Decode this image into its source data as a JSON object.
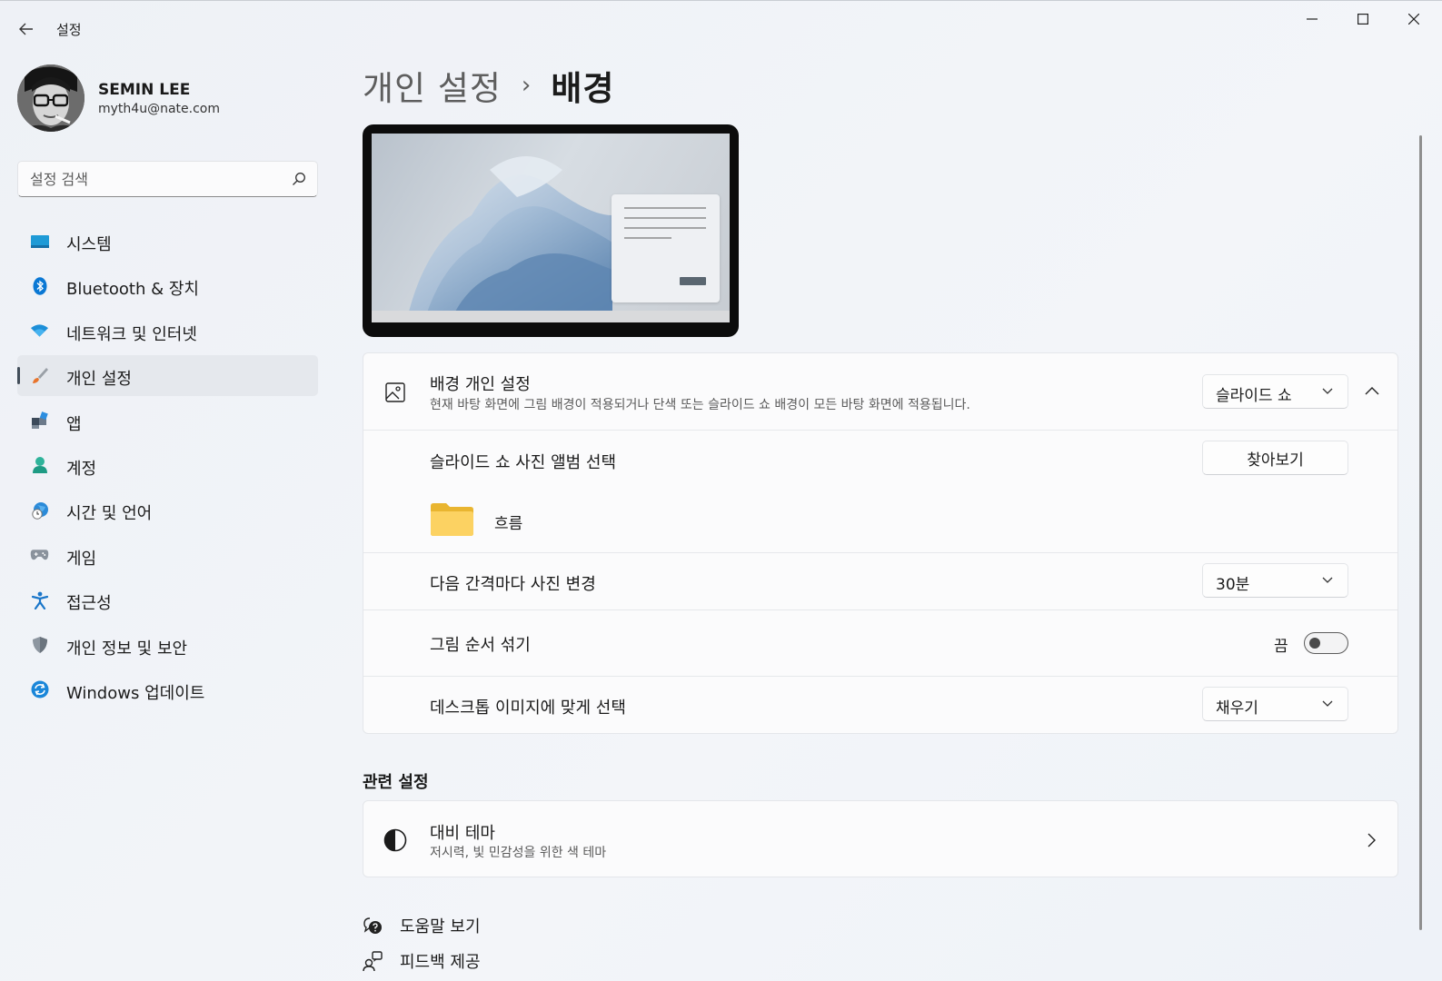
{
  "window": {
    "app_title": "설정"
  },
  "profile": {
    "name": "SEMIN LEE",
    "email": "myth4u@nate.com"
  },
  "search": {
    "placeholder": "설정 검색"
  },
  "nav": {
    "items": [
      {
        "label": "시스템",
        "icon": "system-icon"
      },
      {
        "label": "Bluetooth & 장치",
        "icon": "bluetooth-icon"
      },
      {
        "label": "네트워크 및 인터넷",
        "icon": "wifi-icon"
      },
      {
        "label": "개인 설정",
        "icon": "brush-icon",
        "active": true
      },
      {
        "label": "앱",
        "icon": "apps-icon"
      },
      {
        "label": "계정",
        "icon": "account-icon"
      },
      {
        "label": "시간 및 언어",
        "icon": "time-language-icon"
      },
      {
        "label": "게임",
        "icon": "gamepad-icon"
      },
      {
        "label": "접근성",
        "icon": "accessibility-icon"
      },
      {
        "label": "개인 정보 및 보안",
        "icon": "shield-icon"
      },
      {
        "label": "Windows 업데이트",
        "icon": "update-icon"
      }
    ]
  },
  "breadcrumb": {
    "parent": "개인 설정",
    "separator": "›",
    "current": "배경"
  },
  "background": {
    "title": "배경 개인 설정",
    "subtitle": "현재 바탕 화면에 그림 배경이 적용되거나 단색 또는 슬라이드 쇼 배경이 모든 바탕 화면에 적용됩니다.",
    "type_value": "슬라이드 쇼",
    "album_label": "슬라이드 쇼 사진 앨범 선택",
    "browse_label": "찾아보기",
    "folder_name": "흐름",
    "interval_label": "다음 간격마다 사진 변경",
    "interval_value": "30분",
    "shuffle_label": "그림 순서 섞기",
    "shuffle_state": "끔",
    "fit_label": "데스크톱 이미지에 맞게 선택",
    "fit_value": "채우기"
  },
  "related": {
    "heading": "관련 설정",
    "contrast_title": "대비 테마",
    "contrast_subtitle": "저시력, 빛 민감성을 위한 색 테마"
  },
  "footer": {
    "help": "도움말 보기",
    "feedback": "피드백 제공"
  },
  "colors": {
    "accent": "#0067c0",
    "active_indicator": "#424e5a",
    "folder": "#f7c948"
  }
}
